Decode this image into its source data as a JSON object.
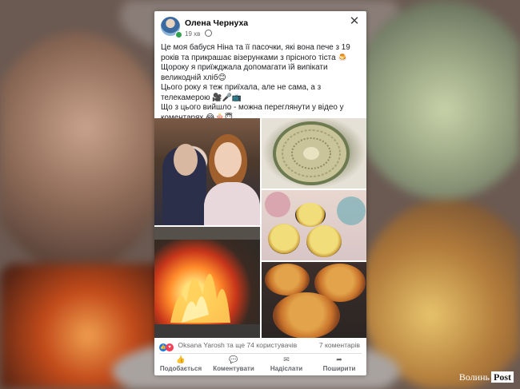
{
  "post": {
    "author": "Олена Чернуха",
    "time": "19 хв",
    "text_lines": [
      "Це моя бабуся Ніна та її пасочки, які вона пече з 19",
      "років та прикрашає візерунками з прісного тіста 🍮",
      "Щороку я приїжджала допомагати їй випікати",
      "великодній хліб😊",
      "Цього року я теж приїхала, але не сама, а з",
      "телекамерою 🎥🎤📺",
      "Що з цього вийшло - можна переглянути у відео у",
      "коментарях 😂🎂😇"
    ]
  },
  "reactions": {
    "names": "Oksana Yarosh та ще 74 користувачів",
    "comments": "7 коментарів"
  },
  "actions": [
    {
      "label": "Подобається",
      "icon": "thumbs-up-icon",
      "glyph": "👍"
    },
    {
      "label": "Коментувати",
      "icon": "comment-icon",
      "glyph": "💬"
    },
    {
      "label": "Надіслати",
      "icon": "messenger-icon",
      "glyph": "✉"
    },
    {
      "label": "Поширити",
      "icon": "share-icon",
      "glyph": "➦"
    }
  ],
  "watermark": {
    "brand": "Волинь",
    "post": "Post"
  }
}
